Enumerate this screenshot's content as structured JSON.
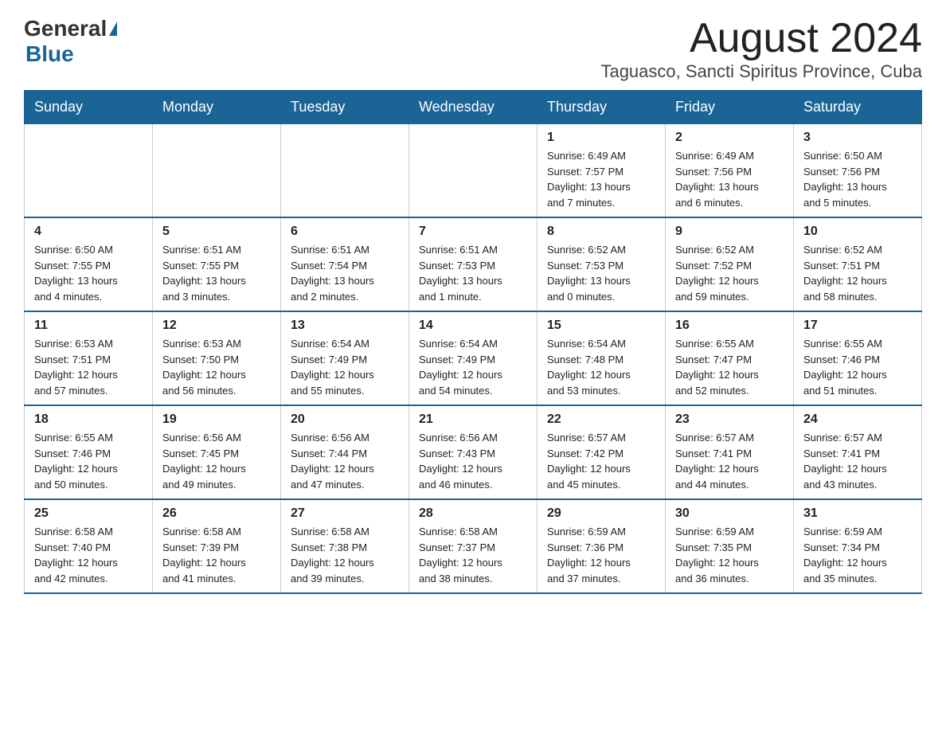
{
  "header": {
    "logo_general": "General",
    "logo_blue": "Blue",
    "month_title": "August 2024",
    "location": "Taguasco, Sancti Spiritus Province, Cuba"
  },
  "weekdays": [
    "Sunday",
    "Monday",
    "Tuesday",
    "Wednesday",
    "Thursday",
    "Friday",
    "Saturday"
  ],
  "weeks": [
    [
      {
        "day": "",
        "info": ""
      },
      {
        "day": "",
        "info": ""
      },
      {
        "day": "",
        "info": ""
      },
      {
        "day": "",
        "info": ""
      },
      {
        "day": "1",
        "info": "Sunrise: 6:49 AM\nSunset: 7:57 PM\nDaylight: 13 hours\nand 7 minutes."
      },
      {
        "day": "2",
        "info": "Sunrise: 6:49 AM\nSunset: 7:56 PM\nDaylight: 13 hours\nand 6 minutes."
      },
      {
        "day": "3",
        "info": "Sunrise: 6:50 AM\nSunset: 7:56 PM\nDaylight: 13 hours\nand 5 minutes."
      }
    ],
    [
      {
        "day": "4",
        "info": "Sunrise: 6:50 AM\nSunset: 7:55 PM\nDaylight: 13 hours\nand 4 minutes."
      },
      {
        "day": "5",
        "info": "Sunrise: 6:51 AM\nSunset: 7:55 PM\nDaylight: 13 hours\nand 3 minutes."
      },
      {
        "day": "6",
        "info": "Sunrise: 6:51 AM\nSunset: 7:54 PM\nDaylight: 13 hours\nand 2 minutes."
      },
      {
        "day": "7",
        "info": "Sunrise: 6:51 AM\nSunset: 7:53 PM\nDaylight: 13 hours\nand 1 minute."
      },
      {
        "day": "8",
        "info": "Sunrise: 6:52 AM\nSunset: 7:53 PM\nDaylight: 13 hours\nand 0 minutes."
      },
      {
        "day": "9",
        "info": "Sunrise: 6:52 AM\nSunset: 7:52 PM\nDaylight: 12 hours\nand 59 minutes."
      },
      {
        "day": "10",
        "info": "Sunrise: 6:52 AM\nSunset: 7:51 PM\nDaylight: 12 hours\nand 58 minutes."
      }
    ],
    [
      {
        "day": "11",
        "info": "Sunrise: 6:53 AM\nSunset: 7:51 PM\nDaylight: 12 hours\nand 57 minutes."
      },
      {
        "day": "12",
        "info": "Sunrise: 6:53 AM\nSunset: 7:50 PM\nDaylight: 12 hours\nand 56 minutes."
      },
      {
        "day": "13",
        "info": "Sunrise: 6:54 AM\nSunset: 7:49 PM\nDaylight: 12 hours\nand 55 minutes."
      },
      {
        "day": "14",
        "info": "Sunrise: 6:54 AM\nSunset: 7:49 PM\nDaylight: 12 hours\nand 54 minutes."
      },
      {
        "day": "15",
        "info": "Sunrise: 6:54 AM\nSunset: 7:48 PM\nDaylight: 12 hours\nand 53 minutes."
      },
      {
        "day": "16",
        "info": "Sunrise: 6:55 AM\nSunset: 7:47 PM\nDaylight: 12 hours\nand 52 minutes."
      },
      {
        "day": "17",
        "info": "Sunrise: 6:55 AM\nSunset: 7:46 PM\nDaylight: 12 hours\nand 51 minutes."
      }
    ],
    [
      {
        "day": "18",
        "info": "Sunrise: 6:55 AM\nSunset: 7:46 PM\nDaylight: 12 hours\nand 50 minutes."
      },
      {
        "day": "19",
        "info": "Sunrise: 6:56 AM\nSunset: 7:45 PM\nDaylight: 12 hours\nand 49 minutes."
      },
      {
        "day": "20",
        "info": "Sunrise: 6:56 AM\nSunset: 7:44 PM\nDaylight: 12 hours\nand 47 minutes."
      },
      {
        "day": "21",
        "info": "Sunrise: 6:56 AM\nSunset: 7:43 PM\nDaylight: 12 hours\nand 46 minutes."
      },
      {
        "day": "22",
        "info": "Sunrise: 6:57 AM\nSunset: 7:42 PM\nDaylight: 12 hours\nand 45 minutes."
      },
      {
        "day": "23",
        "info": "Sunrise: 6:57 AM\nSunset: 7:41 PM\nDaylight: 12 hours\nand 44 minutes."
      },
      {
        "day": "24",
        "info": "Sunrise: 6:57 AM\nSunset: 7:41 PM\nDaylight: 12 hours\nand 43 minutes."
      }
    ],
    [
      {
        "day": "25",
        "info": "Sunrise: 6:58 AM\nSunset: 7:40 PM\nDaylight: 12 hours\nand 42 minutes."
      },
      {
        "day": "26",
        "info": "Sunrise: 6:58 AM\nSunset: 7:39 PM\nDaylight: 12 hours\nand 41 minutes."
      },
      {
        "day": "27",
        "info": "Sunrise: 6:58 AM\nSunset: 7:38 PM\nDaylight: 12 hours\nand 39 minutes."
      },
      {
        "day": "28",
        "info": "Sunrise: 6:58 AM\nSunset: 7:37 PM\nDaylight: 12 hours\nand 38 minutes."
      },
      {
        "day": "29",
        "info": "Sunrise: 6:59 AM\nSunset: 7:36 PM\nDaylight: 12 hours\nand 37 minutes."
      },
      {
        "day": "30",
        "info": "Sunrise: 6:59 AM\nSunset: 7:35 PM\nDaylight: 12 hours\nand 36 minutes."
      },
      {
        "day": "31",
        "info": "Sunrise: 6:59 AM\nSunset: 7:34 PM\nDaylight: 12 hours\nand 35 minutes."
      }
    ]
  ]
}
